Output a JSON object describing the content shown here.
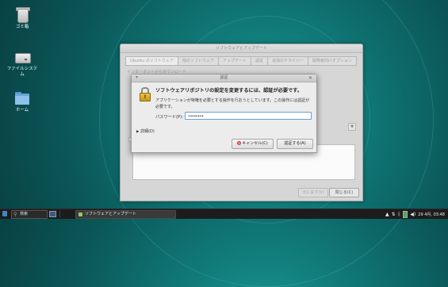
{
  "desktop": {
    "icons": [
      {
        "label": "ゴミ箱",
        "icon": "trash-icon"
      },
      {
        "label": "ファイルシステム",
        "icon": "drive-icon"
      },
      {
        "label": "ホーム",
        "icon": "home-folder-icon"
      }
    ]
  },
  "main_window": {
    "title": "ソフトウェアとアップデート",
    "tabs": [
      "Ubuntu のソフトウェア",
      "他のソフトウェア",
      "アップデート",
      "認証",
      "追加のドライバー",
      "開発者向けオプション"
    ],
    "download_from_label": "インターネットからダウンロード",
    "revert_button": "元に戻す(V)",
    "close_button": "閉じる(C)"
  },
  "auth_dialog": {
    "title": "認証",
    "heading": "ソフトウェアリポジトリの設定を変更するには、認証が必要です。",
    "description": "アプリケーションが特権を必要とする操作を行おうとしています。この操作には認証が必要です。",
    "password_label": "パスワード(P):",
    "password_value": "••••••••",
    "details_label": "詳細(D)",
    "cancel_button": "キャンセル(C)",
    "authenticate_button": "認証する(A)"
  },
  "taskbar": {
    "search_label": "検索",
    "task_label": "ソフトウェアとアップデート",
    "clock": "29 4月, 03:48"
  }
}
